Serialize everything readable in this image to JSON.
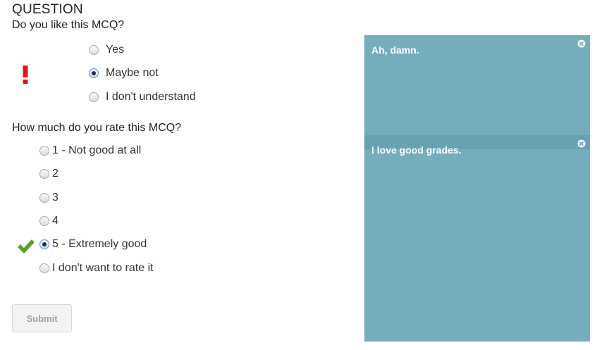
{
  "question": {
    "heading": "QUESTION",
    "text": "Do you like this MCQ?",
    "options": [
      {
        "label": "Yes",
        "checked": false
      },
      {
        "label": "Maybe not",
        "checked": true
      },
      {
        "label": "I don't understand",
        "checked": false
      }
    ],
    "status_icon": "exclamation-icon",
    "status_color": "#e0141e"
  },
  "rating": {
    "text": "How much do you rate this MCQ?",
    "options": [
      {
        "label": "1 - Not good at all",
        "checked": false
      },
      {
        "label": "2",
        "checked": false
      },
      {
        "label": "3",
        "checked": false
      },
      {
        "label": "4",
        "checked": false
      },
      {
        "label": "5 - Extremely good",
        "checked": true
      },
      {
        "label": "I don't want to rate it",
        "checked": false
      }
    ],
    "status_icon": "checkmark-icon",
    "status_color": "#5a9e2f"
  },
  "submit": {
    "label": "Submit"
  },
  "feedback": [
    {
      "message": "Ah, damn.",
      "close_icon": "close-icon"
    },
    {
      "message": "I love good grades.",
      "close_icon": "close-icon"
    }
  ],
  "colors": {
    "feedback_panel": "#76adbc",
    "feedback_band": "#66a2b2"
  }
}
